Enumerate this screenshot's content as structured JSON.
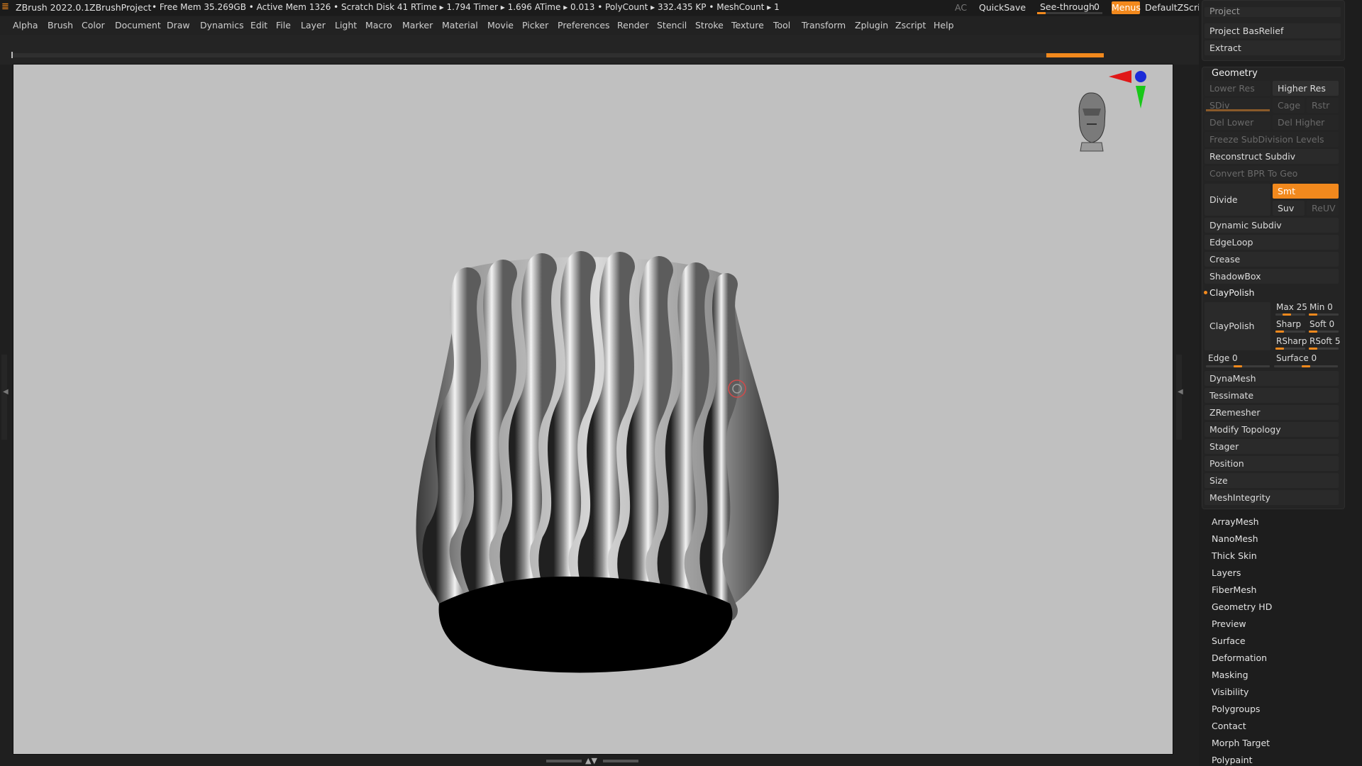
{
  "titlebar": {
    "app": "ZBrush 2022.0.1",
    "project": "ZBrushProject",
    "stats": "• Free Mem 35.269GB • Active Mem 1326 • Scratch Disk 41  RTime ▸ 1.794 Timer ▸ 1.696 ATime ▸ 0.013 • PolyCount ▸ 332.435 KP  • MeshCount ▸ 1",
    "ac": "AC",
    "quicksave": "QuickSave",
    "seethrough": "See-through",
    "seethrough_value": "0",
    "menus": "Menus",
    "script": "DefaultZScript"
  },
  "menu": [
    "Alpha",
    "Brush",
    "Color",
    "Document",
    "Draw",
    "Dynamics",
    "Edit",
    "File",
    "Layer",
    "Light",
    "Macro",
    "Marker",
    "Material",
    "Movie",
    "Picker",
    "Preferences",
    "Render",
    "Stencil",
    "Stroke",
    "Texture",
    "Tool",
    "Transform",
    "Zplugin",
    "Zscript",
    "Help"
  ],
  "palette": {
    "top_cut": "Project",
    "project_basrelief": "Project BasRelief",
    "extract": "Extract",
    "geometry_title": "Geometry",
    "lower_res": "Lower Res",
    "higher_res": "Higher Res",
    "sdiv": "SDiv",
    "cage": "Cage",
    "rstr": "Rstr",
    "del_lower": "Del Lower",
    "del_higher": "Del Higher",
    "freeze": "Freeze SubDivision Levels",
    "reconstruct": "Reconstruct Subdiv",
    "convert_bpr": "Convert BPR To Geo",
    "divide": "Divide",
    "smt": "Smt",
    "suv": "Suv",
    "reuv": "ReUV",
    "dynamic_subdiv": "Dynamic Subdiv",
    "edgeloop": "EdgeLoop",
    "crease": "Crease",
    "shadowbox": "ShadowBox",
    "claypolish_title": "ClayPolish",
    "claypolish_btn": "ClayPolish",
    "max_label": "Max 25",
    "min_label": "Min 0",
    "sharp_label": "Sharp",
    "soft_label": "Soft 0",
    "rsharp_label": "RSharp",
    "rsoft_label": "RSoft 5",
    "edge_label": "Edge 0",
    "surface_label": "Surface 0",
    "items_a": [
      "DynaMesh",
      "Tessimate",
      "ZRemesher",
      "Modify Topology",
      "Stager",
      "Position",
      "Size",
      "MeshIntegrity"
    ],
    "items_b": [
      "ArrayMesh",
      "NanoMesh",
      "Thick Skin",
      "Layers",
      "FiberMesh",
      "Geometry HD",
      "Preview",
      "Surface",
      "Deformation",
      "Masking",
      "Visibility",
      "Polygroups",
      "Contact",
      "Morph Target",
      "Polypaint"
    ]
  },
  "colors": {
    "accent": "#f2891d",
    "viewport_bg": "#c0c0c0"
  }
}
